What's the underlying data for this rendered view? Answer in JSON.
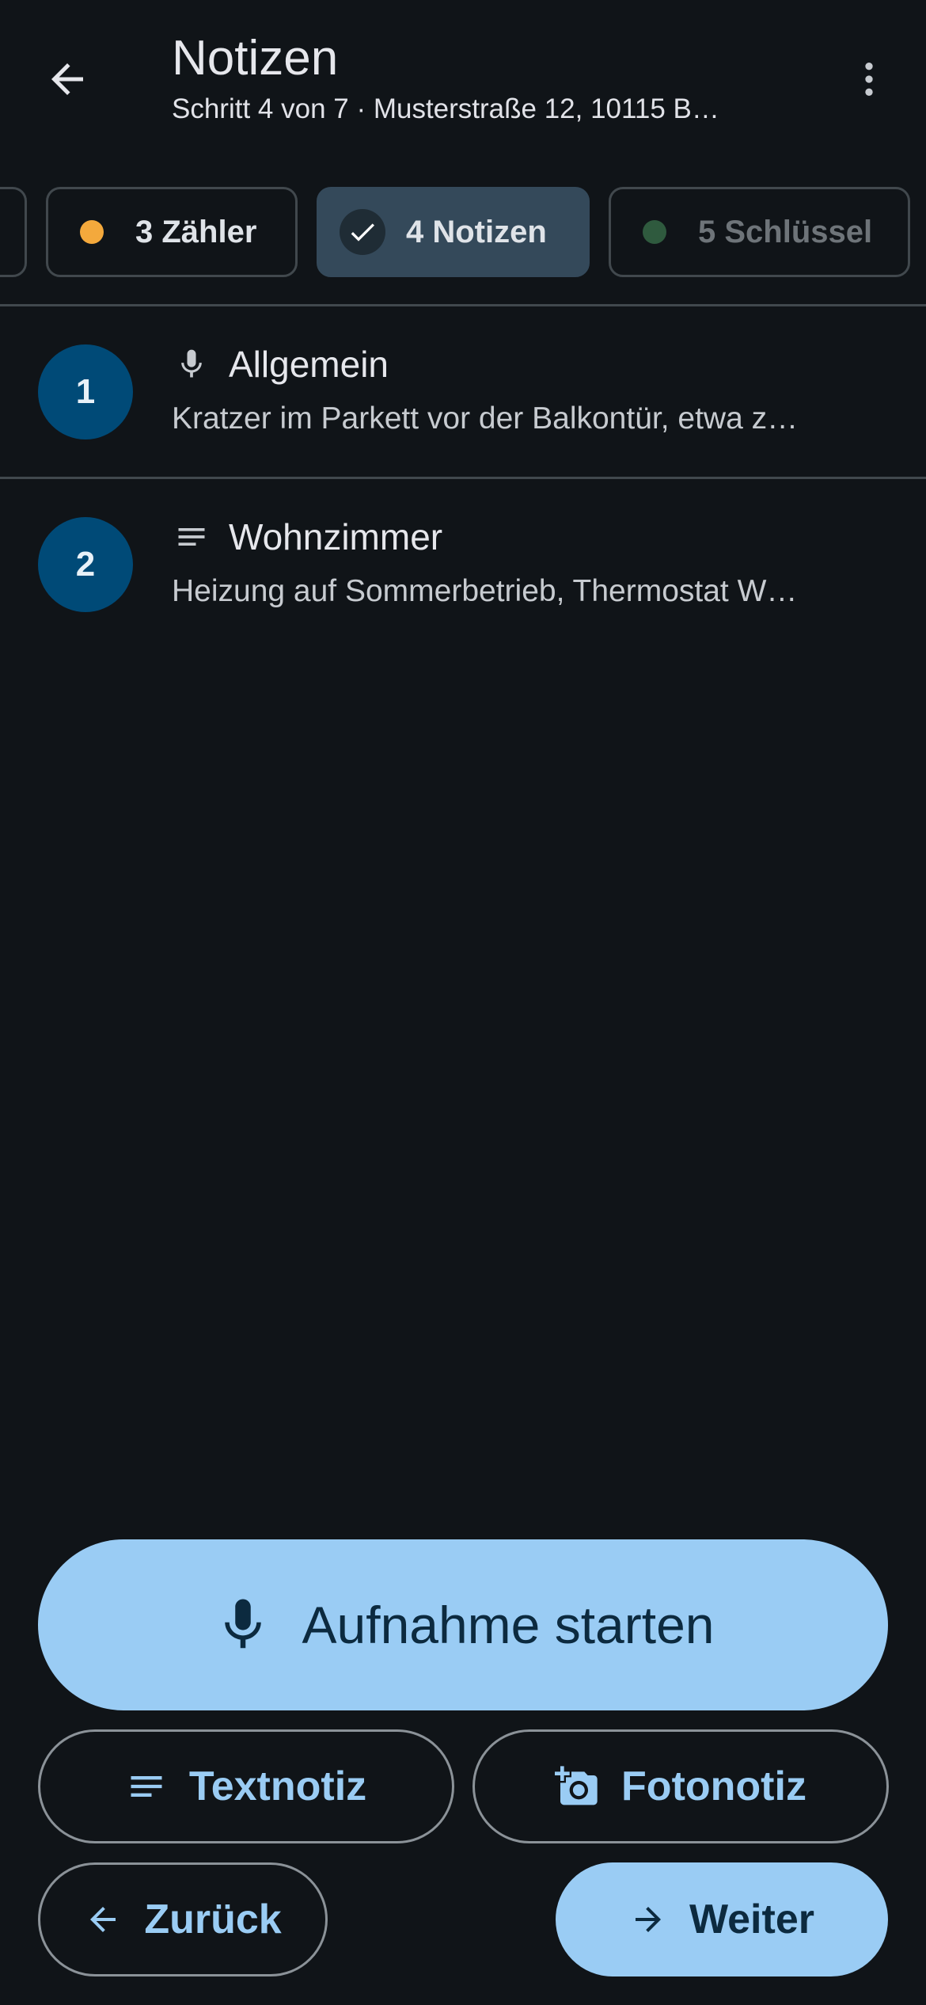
{
  "header": {
    "title": "Notizen",
    "subtitle": "Schritt 4 von 7 · Musterstraße 12, 10115 B…"
  },
  "tabs": [
    {
      "label": "3 Zähler",
      "status_color": "#f4a93c"
    },
    {
      "label": "4 Notizen",
      "status": "done"
    },
    {
      "label": "5 Schlüssel",
      "status_color": "#2f5a3e"
    }
  ],
  "notes": [
    {
      "number": "1",
      "type_icon": "mic-icon",
      "title": "Allgemein",
      "preview": "Kratzer im Parkett vor der Balkontür, etwa z…"
    },
    {
      "number": "2",
      "type_icon": "text-lines-icon",
      "title": "Wohnzimmer",
      "preview": "Heizung auf Sommerbetrieb, Thermostat W…"
    }
  ],
  "actions": {
    "record_label": "Aufnahme starten",
    "text_note_label": "Textnotiz",
    "photo_note_label": "Fotonotiz",
    "back_label": "Zurück",
    "next_label": "Weiter"
  },
  "colors": {
    "background": "#101418",
    "primary": "#9accf4",
    "on_primary": "#0c2a3f",
    "badge": "#004a77",
    "selected_chip": "#34495a"
  }
}
